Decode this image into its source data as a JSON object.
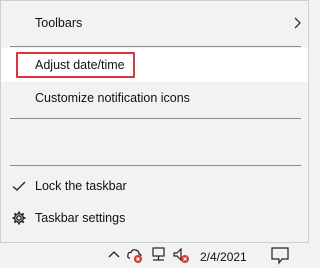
{
  "menu": {
    "items": [
      {
        "label": "Toolbars",
        "has_submenu": true
      },
      {
        "label": "Adjust date/time"
      },
      {
        "label": "Customize notification icons"
      },
      {
        "label": "Lock the taskbar",
        "checked": true
      },
      {
        "label": "Taskbar settings",
        "icon": "gear-icon"
      }
    ]
  },
  "taskbar": {
    "date": "2/4/2021",
    "icons": [
      "chevron-up-icon",
      "cloud-error-icon",
      "network-icon",
      "volume-muted-icon",
      "notification-icon"
    ]
  },
  "colors": {
    "highlight_border": "#d9353b",
    "menu_bg": "#f2f2f2",
    "separator": "#8c8c8c"
  }
}
